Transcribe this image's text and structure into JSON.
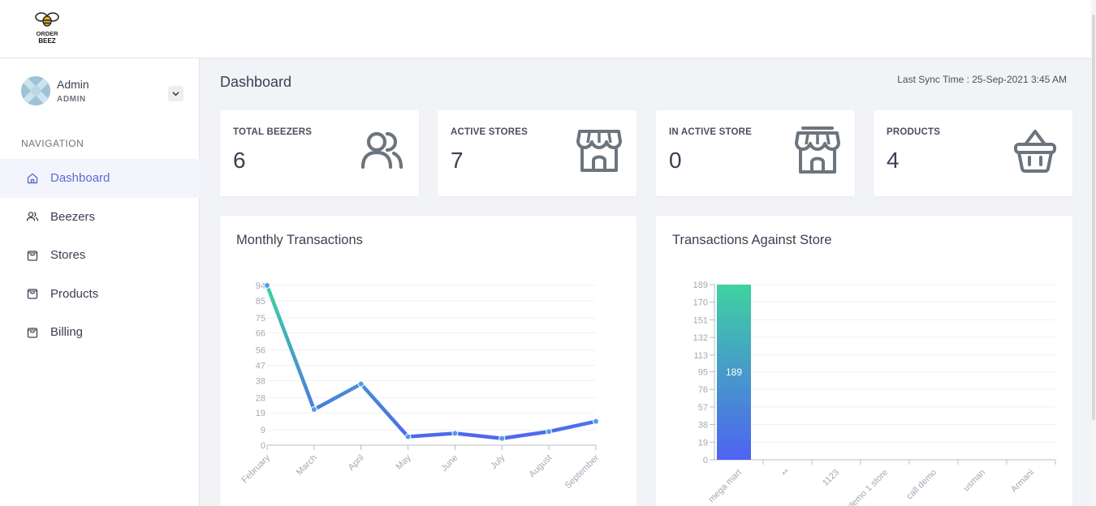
{
  "brand": {
    "logo_text_line1": "ORDER",
    "logo_text_line2": "BEEZ"
  },
  "user": {
    "name": "Admin",
    "role": "ADMIN"
  },
  "nav": {
    "title": "NAVIGATION",
    "items": [
      {
        "label": "Dashboard",
        "icon": "home-icon",
        "active": true
      },
      {
        "label": "Beezers",
        "icon": "users-icon",
        "active": false
      },
      {
        "label": "Stores",
        "icon": "shopping-bag-icon",
        "active": false
      },
      {
        "label": "Products",
        "icon": "shopping-bag-icon",
        "active": false
      },
      {
        "label": "Billing",
        "icon": "shopping-bag-icon",
        "active": false
      }
    ]
  },
  "header": {
    "title": "Dashboard",
    "sync_text": "Last Sync Time : 25-Sep-2021 3:45 AM"
  },
  "stats": [
    {
      "label": "TOTAL BEEZERS",
      "value": "6",
      "icon": "users-icon"
    },
    {
      "label": "ACTIVE STORES",
      "value": "7",
      "icon": "store-icon"
    },
    {
      "label": "IN ACTIVE STORE",
      "value": "0",
      "icon": "store-icon"
    },
    {
      "label": "PRODUCTS",
      "value": "4",
      "icon": "basket-icon"
    }
  ],
  "colors": {
    "accent": "#5c6bd6",
    "icon_gray": "#6c757d",
    "gradient_top": "#3fd2a0",
    "gradient_bottom": "#4e63f2"
  },
  "chart_data": [
    {
      "type": "line",
      "title": "Monthly Transactions",
      "categories": [
        "February",
        "March",
        "April",
        "May",
        "June",
        "July",
        "August",
        "September"
      ],
      "values": [
        94,
        21,
        36,
        5,
        7,
        4,
        8,
        14
      ],
      "yticks": [
        "0",
        "9",
        "19",
        "28",
        "38",
        "47",
        "56",
        "66",
        "75",
        "85",
        "94"
      ],
      "ylim": [
        0,
        94
      ],
      "grid": true
    },
    {
      "type": "bar",
      "title": "Transactions Against Store",
      "categories": [
        "mega mart",
        "**",
        "1123",
        "demo 1 store",
        "call demo",
        "usman",
        "Armani"
      ],
      "values": [
        189,
        0,
        0,
        0,
        0,
        0,
        0
      ],
      "data_labels": [
        "189"
      ],
      "yticks": [
        "0",
        "19",
        "38",
        "57",
        "76",
        "95",
        "113",
        "132",
        "151",
        "170",
        "189"
      ],
      "ylim": [
        0,
        189
      ],
      "grid": true
    }
  ]
}
